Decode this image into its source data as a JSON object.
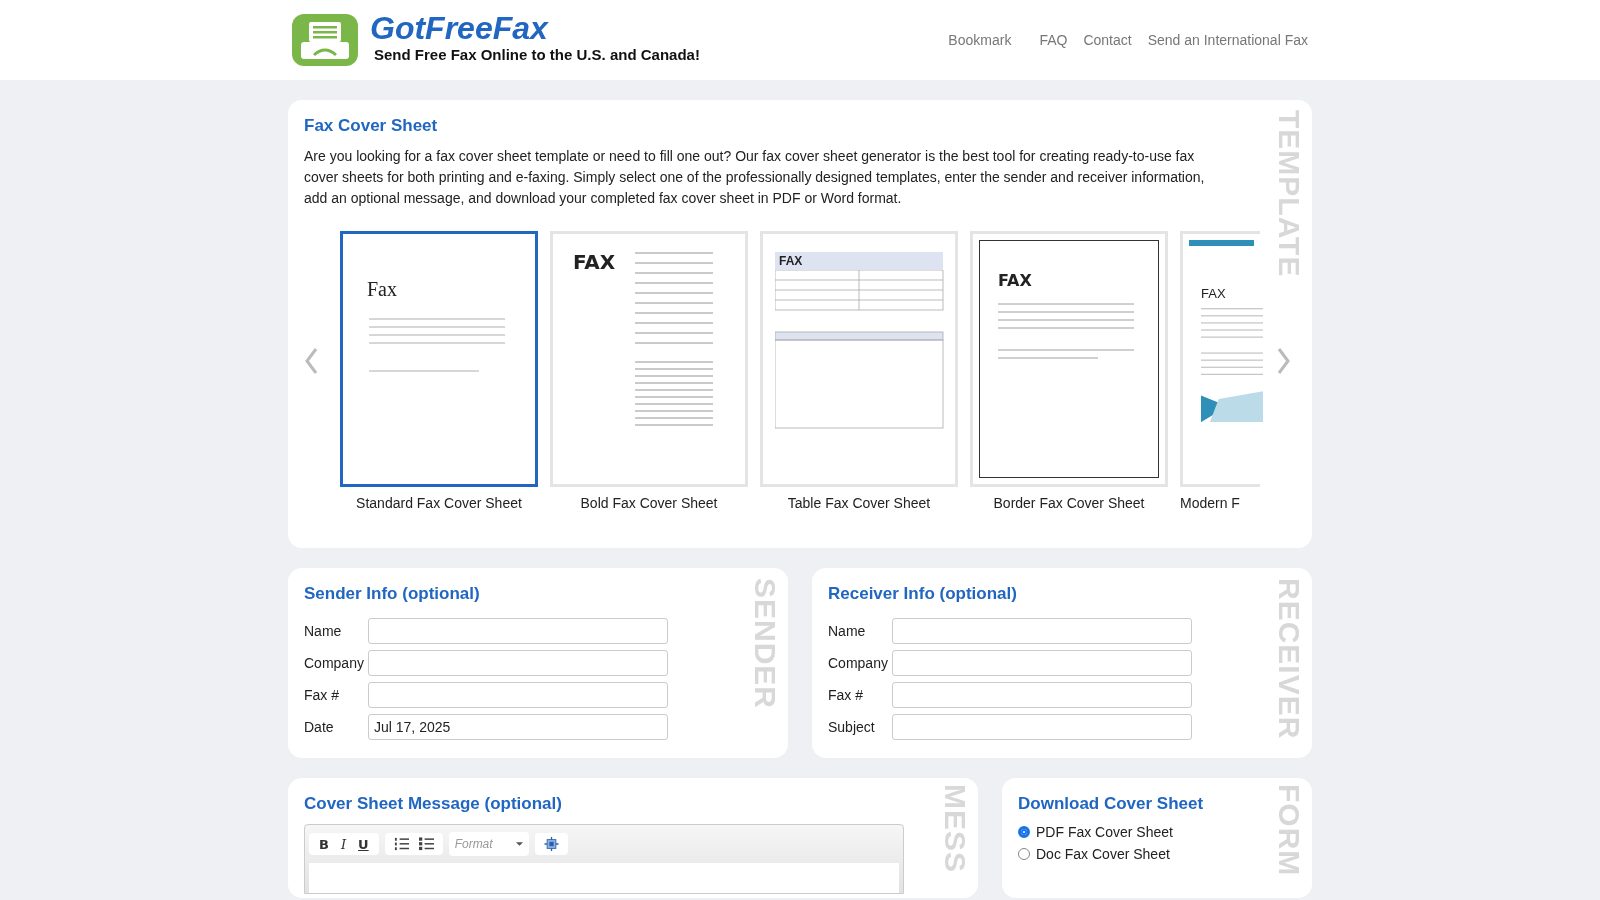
{
  "header": {
    "logo_text": "GotFreeFax",
    "tagline": "Send Free Fax Online to the U.S. and Canada!",
    "nav": [
      "Bookmark",
      "FAQ",
      "Contact",
      "Send an International Fax"
    ]
  },
  "template_section": {
    "title": "Fax Cover Sheet",
    "side_label": "TEMPLATE",
    "description": "Are you looking for a fax cover sheet template or need to fill one out? Our fax cover sheet generator is the best tool for creating ready-to-use fax cover sheets for both printing and e-faxing. Simply select one of the professionally designed templates, enter the sender and receiver information, add an optional message, and download your completed fax cover sheet in PDF or Word format.",
    "templates": [
      {
        "kind": "standard",
        "preview_title": "Fax",
        "label": "Standard Fax Cover Sheet",
        "selected": true
      },
      {
        "kind": "bold",
        "preview_title": "FAX",
        "label": "Bold Fax Cover Sheet",
        "selected": false
      },
      {
        "kind": "table",
        "preview_title": "FAX",
        "label": "Table Fax Cover Sheet",
        "selected": false
      },
      {
        "kind": "border",
        "preview_title": "FAX",
        "label": "Border Fax Cover Sheet",
        "selected": false
      },
      {
        "kind": "modern",
        "preview_title": "FAX",
        "label": "Modern F",
        "selected": false
      }
    ]
  },
  "sender": {
    "title": "Sender Info (optional)",
    "side_label": "SENDER",
    "fields": [
      {
        "label": "Name"
      },
      {
        "label": "Company"
      },
      {
        "label": "Fax #"
      },
      {
        "label": "Date",
        "value": "Jul 17, 2025"
      }
    ]
  },
  "receiver": {
    "title": "Receiver Info (optional)",
    "side_label": "RECEIVER",
    "fields": [
      {
        "label": "Name"
      },
      {
        "label": "Company"
      },
      {
        "label": "Fax #"
      },
      {
        "label": "Subject"
      }
    ]
  },
  "message": {
    "title": "Cover Sheet Message (optional)",
    "side_label": "MESS",
    "toolbar": {
      "bold": "B",
      "italic": "I",
      "underline": "U",
      "format_placeholder": "Format"
    }
  },
  "download": {
    "title": "Download Cover Sheet",
    "side_label": "FORM",
    "options": [
      {
        "label": "PDF Fax Cover Sheet",
        "selected": true
      },
      {
        "label": "Doc Fax Cover Sheet",
        "selected": false
      }
    ]
  }
}
